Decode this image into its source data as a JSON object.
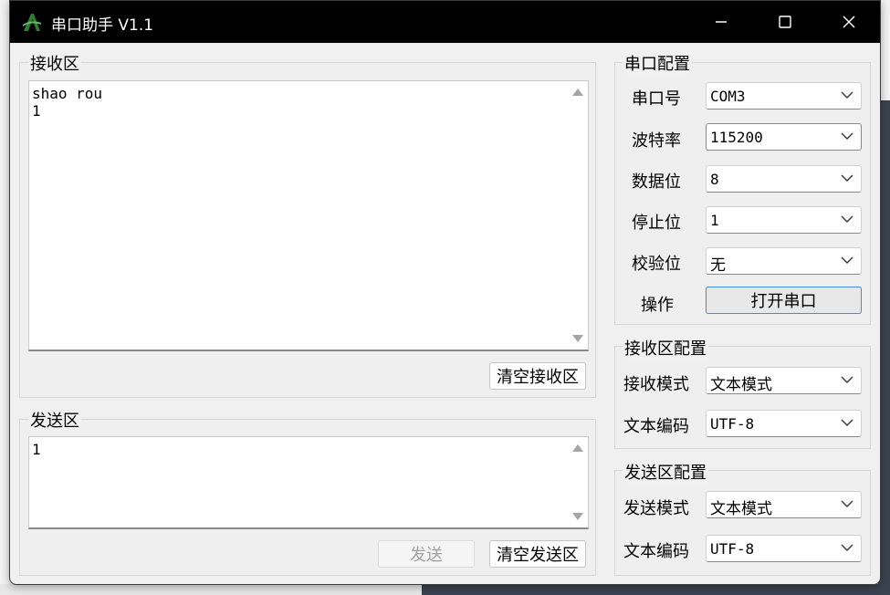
{
  "window": {
    "title": "串口助手 V1.1",
    "icon": "app-logo-icon",
    "controls": [
      "minimize-icon",
      "maximize-icon",
      "close-icon"
    ]
  },
  "receive": {
    "group_title": "接收区",
    "text": "shao rou\n1",
    "clear_button": "清空接收区"
  },
  "send": {
    "group_title": "发送区",
    "text": "1",
    "send_button": "发送",
    "clear_button": "清空发送区"
  },
  "port_config": {
    "group_title": "串口配置",
    "port_label": "串口号",
    "port_value": "COM3",
    "baud_label": "波特率",
    "baud_value": "115200",
    "databits_label": "数据位",
    "databits_value": "8",
    "stopbits_label": "停止位",
    "stopbits_value": "1",
    "parity_label": "校验位",
    "parity_value": "无",
    "action_label": "操作",
    "open_button": "打开串口"
  },
  "receive_config": {
    "group_title": "接收区配置",
    "mode_label": "接收模式",
    "mode_value": "文本模式",
    "encoding_label": "文本编码",
    "encoding_value": "UTF-8"
  },
  "send_config": {
    "group_title": "发送区配置",
    "mode_label": "发送模式",
    "mode_value": "文本模式",
    "encoding_label": "文本编码",
    "encoding_value": "UTF-8"
  },
  "colors": {
    "titlebar": "#000000",
    "window_bg": "#f0f0f0",
    "focus_accent": "#3d8ee3",
    "logo_green": "#2e7d32"
  }
}
